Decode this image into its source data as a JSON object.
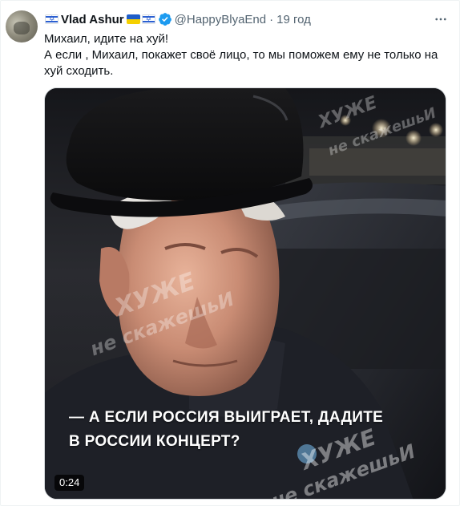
{
  "tweet": {
    "author": {
      "display_name": "Vlad Ashur",
      "handle": "@HappyBlyaEnd",
      "verified": true,
      "flags_before": [
        "flag-israel-icon"
      ],
      "flags_after": [
        "flag-ukraine-icon",
        "flag-israel-icon"
      ]
    },
    "separator": "·",
    "time": "19 год",
    "more_icon": "more-horizontal-icon",
    "text_lines": [
      "Михаил, идите на хуй!",
      "А если , Михаил, покажет своё лицо, то мы поможем ему не только на хуй сходить."
    ],
    "media": {
      "type": "video",
      "duration": "0:24",
      "subtitle_lines": [
        "— А ЕСЛИ РОССИЯ ВЫИГРАЕТ, ДАДИТЕ",
        "В РОССИИ КОНЦЕРТ?"
      ],
      "watermark": {
        "line1": "ХУЖЕ",
        "line2": "не скажешьИ"
      }
    }
  },
  "colors": {
    "text_primary": "#0f1419",
    "text_secondary": "#536471",
    "verified_blue": "#1d9bf0"
  }
}
